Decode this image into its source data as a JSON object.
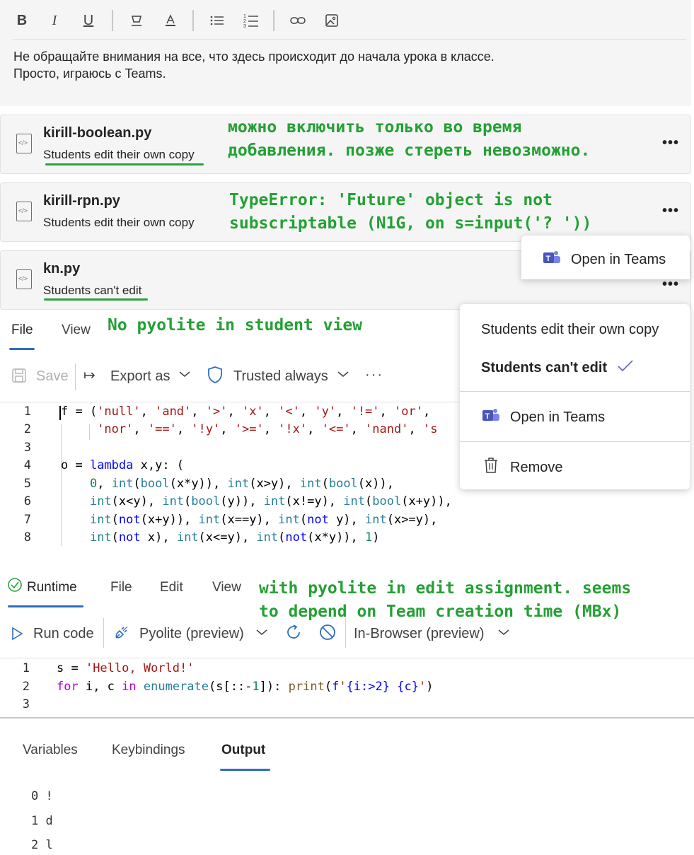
{
  "rte": {
    "line1": "Не обращайте внимания на все, что здесь происходит до начала урока в классе.",
    "line2": "Просто, играюсь с Teams."
  },
  "cards": [
    {
      "name": "kirill-boolean.py",
      "sub": "Students edit their own copy"
    },
    {
      "name": "kirill-rpn.py",
      "sub": "Students edit their own copy"
    },
    {
      "name": "kn.py",
      "sub": "Students can't edit"
    }
  ],
  "notes": {
    "n1": "можно включить только во время\nдобавления. позже стереть невозможно.",
    "n2": "TypeError: 'Future' object is not\nsubscriptable (N1G, on s=input('? '))",
    "n3": "No pyolite in student view",
    "n4": "with pyolite in edit assignment. seems\nto depend on Team creation time (MBx)"
  },
  "tooltip": {
    "open_in_teams": "Open in Teams"
  },
  "context_menu": {
    "item1": "Students edit their own copy",
    "item2": "Students can't edit",
    "item3": "Open in Teams",
    "item4": "Remove"
  },
  "viewer": {
    "tab_file": "File",
    "tab_view": "View",
    "save": "Save",
    "export": "Export as",
    "trusted": "Trusted always",
    "more": "···"
  },
  "editor": {
    "tab_runtime": "Runtime",
    "tab_file": "File",
    "tab_edit": "Edit",
    "tab_view": "View",
    "run": "Run code",
    "kernel": "Pyolite (preview)",
    "env": "In-Browser (preview)"
  },
  "code1_lines": [
    "1",
    "2",
    "3",
    "4",
    "5",
    "6",
    "7",
    "8"
  ],
  "code2_lines": [
    "1",
    "2",
    "3"
  ],
  "bottom_tabs": {
    "variables": "Variables",
    "keybindings": "Keybindings",
    "output": "Output"
  },
  "output": [
    "0 !",
    "1 d",
    "2 l"
  ]
}
